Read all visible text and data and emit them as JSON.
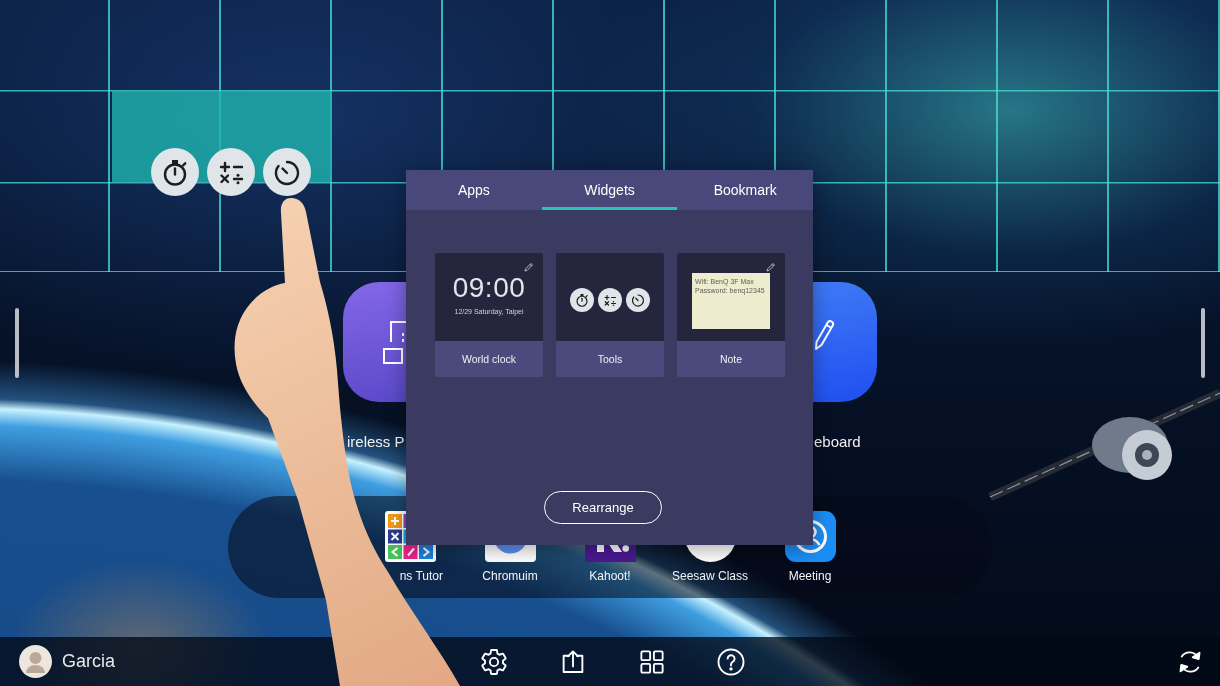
{
  "placement_grid": {
    "drop_zone": true
  },
  "floating_widget": {
    "tools": [
      {
        "kind": "stopwatch"
      },
      {
        "kind": "math"
      },
      {
        "kind": "timer"
      }
    ]
  },
  "home_apps": [
    {
      "kind": "screens",
      "label": "ireless P"
    },
    {
      "kind": "pencil",
      "label": "eboard"
    }
  ],
  "dock": {
    "apps": [
      {
        "kind": "math_grid",
        "label": "ns Tutor"
      },
      {
        "kind": "browser",
        "label": "Chromuim"
      },
      {
        "kind": "quiz",
        "label": "Kahoot!"
      },
      {
        "kind": "circle",
        "label": "Seesaw Class"
      },
      {
        "kind": "meeting",
        "label": "Meeting"
      }
    ]
  },
  "widget_panel": {
    "tabs": [
      {
        "label": "Apps",
        "selected": false
      },
      {
        "label": "Widgets",
        "selected": true
      },
      {
        "label": "Bookmark",
        "selected": false
      }
    ],
    "widgets": [
      {
        "kind": "clock",
        "label": "World clock",
        "time": "09:00",
        "date": "12/29 Saturday, Taipei",
        "editable": true
      },
      {
        "kind": "tools",
        "label": "Tools",
        "tools": [
          {
            "kind": "stopwatch"
          },
          {
            "kind": "math"
          },
          {
            "kind": "timer"
          }
        ],
        "editable": false
      },
      {
        "kind": "note",
        "label": "Note",
        "note_lines": [
          "Wifi: BenQ 3F Max",
          "Password: benq12345"
        ],
        "editable": true
      }
    ],
    "button": "Rearrange"
  },
  "taskbar": {
    "user_name": "Garcia",
    "buttons": [
      {
        "kind": "settings"
      },
      {
        "kind": "share"
      },
      {
        "kind": "apps"
      },
      {
        "kind": "help"
      }
    ],
    "end_buttons": [
      {
        "kind": "refresh"
      }
    ]
  }
}
